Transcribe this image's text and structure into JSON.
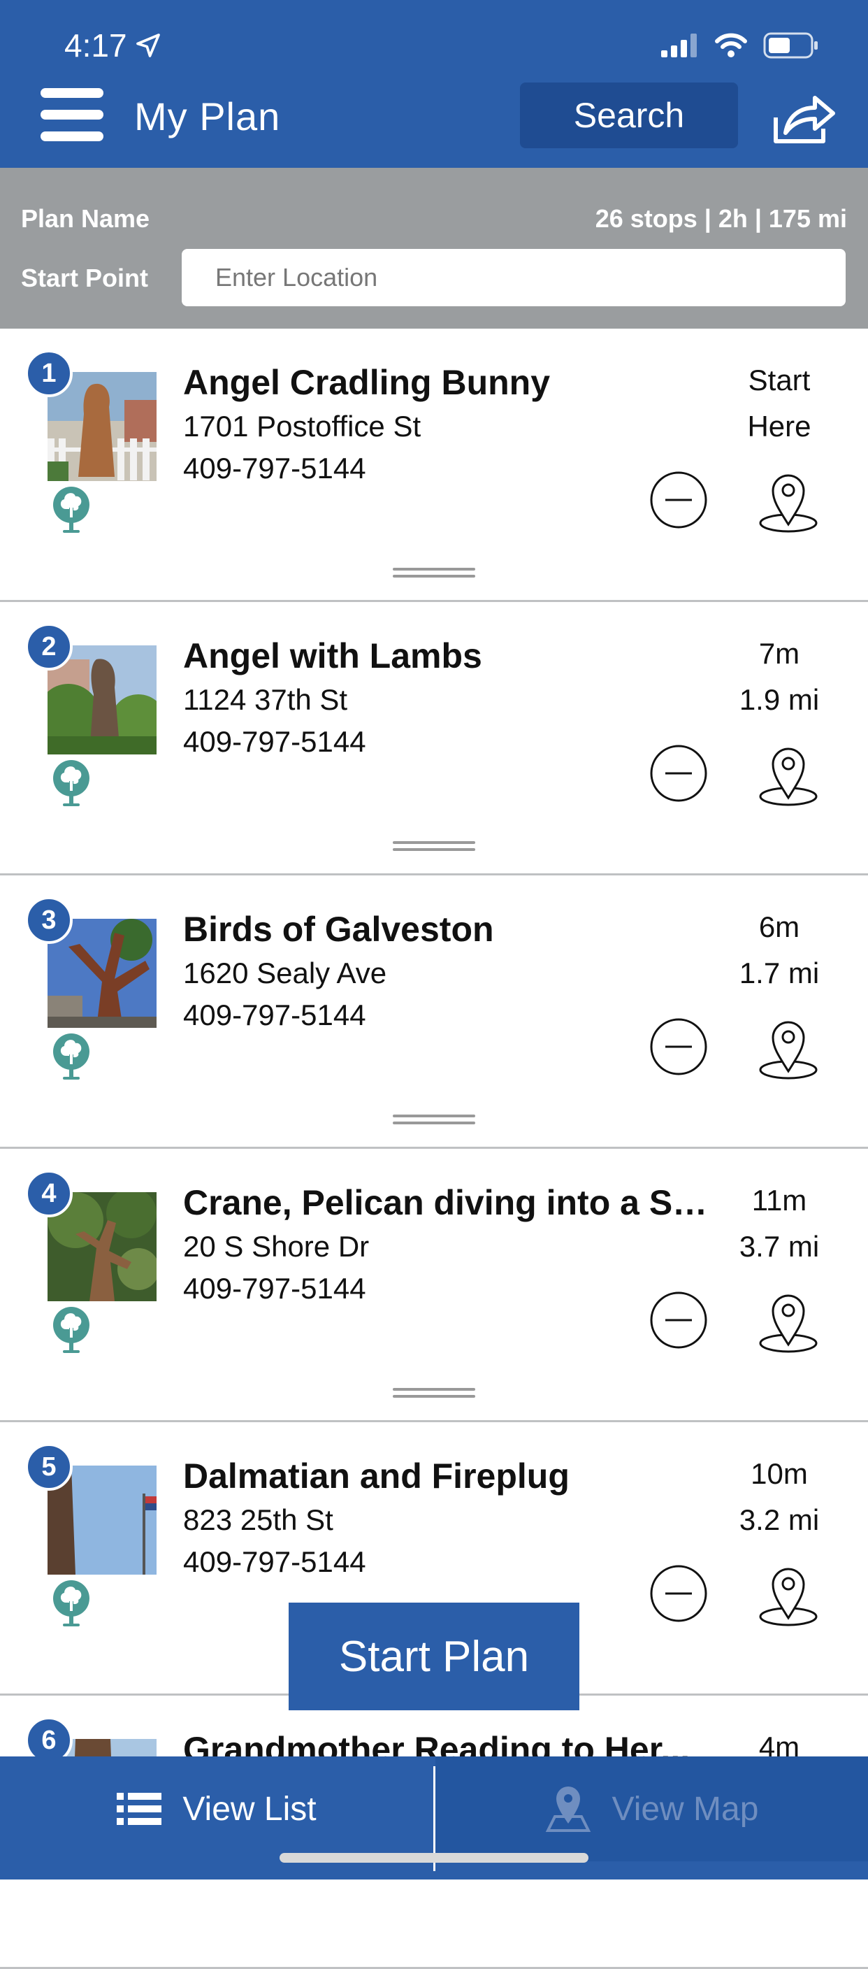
{
  "status_bar": {
    "time": "4:17"
  },
  "header": {
    "title": "My Plan",
    "search_label": "Search"
  },
  "plan": {
    "name_label": "Plan Name",
    "summary": "26 stops | 2h | 175 mi",
    "start_point_label": "Start Point",
    "start_point_placeholder": "Enter Location"
  },
  "stops": [
    {
      "number": "1",
      "title": "Angel Cradling Bunny",
      "address": "1701 Postoffice St",
      "phone": "409-797-5144",
      "time": "Start",
      "distance": "Here"
    },
    {
      "number": "2",
      "title": "Angel with Lambs",
      "address": "1124 37th St",
      "phone": "409-797-5144",
      "time": "7m",
      "distance": "1.9 mi"
    },
    {
      "number": "3",
      "title": "Birds of Galveston",
      "address": "1620 Sealy Ave",
      "phone": "409-797-5144",
      "time": "6m",
      "distance": "1.7 mi"
    },
    {
      "number": "4",
      "title": "Crane, Pelican diving into a Sc...",
      "address": "20 S Shore Dr",
      "phone": "409-797-5144",
      "time": "11m",
      "distance": "3.7 mi"
    },
    {
      "number": "5",
      "title": "Dalmatian and Fireplug",
      "address": "823 25th St",
      "phone": "409-797-5144",
      "time": "10m",
      "distance": "3.2 mi"
    },
    {
      "number": "6",
      "title": "Grandmother Reading to Her...",
      "address": "",
      "phone": "",
      "time": "4m",
      "distance": ""
    }
  ],
  "start_plan_label": "Start Plan",
  "tabs": {
    "list_label": "View List",
    "map_label": "View Map"
  },
  "colors": {
    "brand_blue": "#2b5ea9",
    "plan_bar_gray": "#9a9d9f",
    "tree_teal": "#4a9a94"
  },
  "icons": [
    "location-arrow-icon",
    "signal-icon",
    "wifi-icon",
    "battery-icon",
    "hamburger-menu-icon",
    "share-icon",
    "tree-icon",
    "remove-icon",
    "map-pin-icon",
    "drag-handle-icon",
    "list-icon"
  ]
}
